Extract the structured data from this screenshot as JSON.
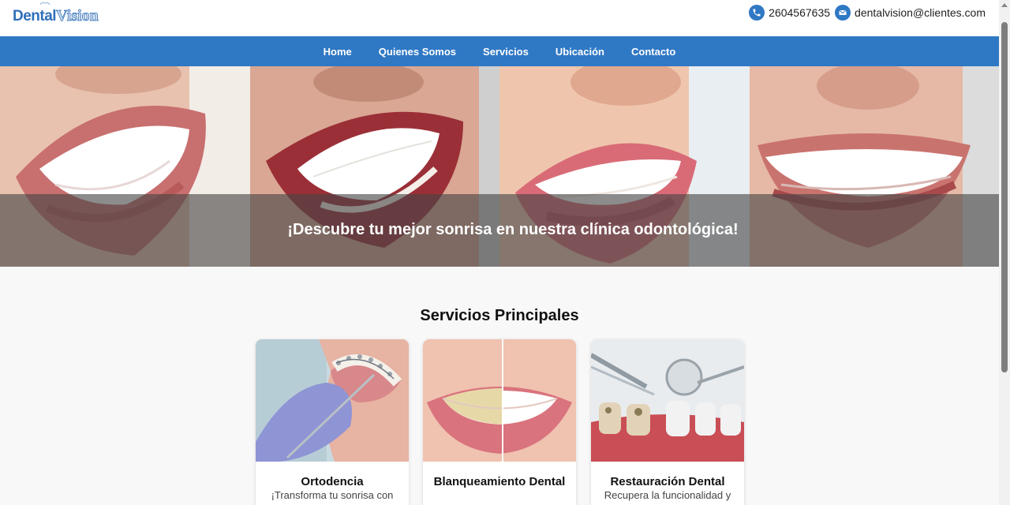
{
  "header": {
    "logo_part1": "Dental",
    "logo_part2": "Vision",
    "phone": "2604567635",
    "email": "dentalvision@clientes.com"
  },
  "nav": {
    "items": [
      "Home",
      "Quienes Somos",
      "Servicios",
      "Ubicación",
      "Contacto"
    ]
  },
  "hero": {
    "caption": "¡Descubre tu mejor sonrisa en nuestra clínica odontológica!"
  },
  "services": {
    "title": "Servicios Principales",
    "cards": [
      {
        "title": "Ortodencia",
        "description": "¡Transforma tu sonrisa con"
      },
      {
        "title": "Blanqueamiento Dental",
        "description": ""
      },
      {
        "title": "Restauración Dental",
        "description": "Recupera la funcionalidad y"
      }
    ]
  },
  "colors": {
    "brand_blue": "#2f78c4",
    "nav_text": "#ffffff",
    "background": "#f8f8f8"
  },
  "icons": {
    "phone": "phone-icon",
    "email": "email-icon"
  }
}
